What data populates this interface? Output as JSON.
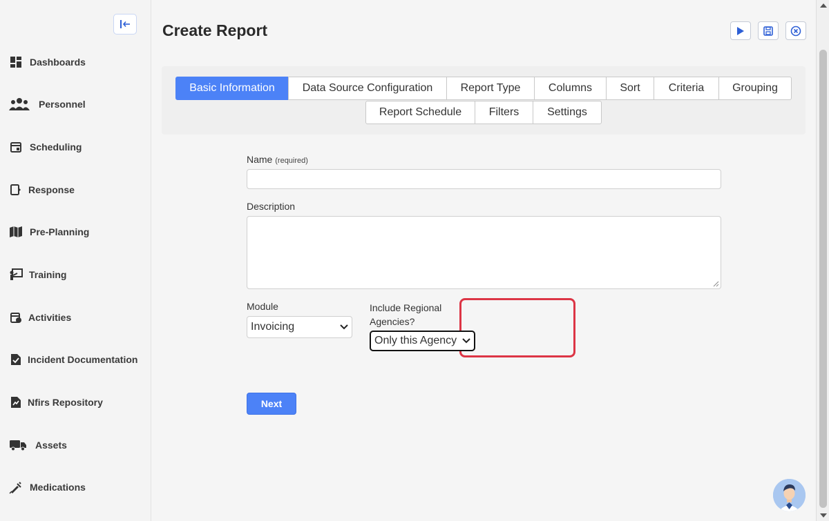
{
  "sidebar": {
    "items": [
      {
        "label": "Dashboards",
        "icon": "dashboard-icon"
      },
      {
        "label": "Personnel",
        "icon": "people-icon"
      },
      {
        "label": "Scheduling",
        "icon": "calendar-icon"
      },
      {
        "label": "Response",
        "icon": "response-icon"
      },
      {
        "label": "Pre-Planning",
        "icon": "map-icon"
      },
      {
        "label": "Training",
        "icon": "training-icon"
      },
      {
        "label": "Activities",
        "icon": "activities-icon"
      },
      {
        "label": "Incident Documentation",
        "icon": "document-check-icon"
      },
      {
        "label": "Nfirs Repository",
        "icon": "document-chart-icon"
      },
      {
        "label": "Assets",
        "icon": "truck-icon"
      },
      {
        "label": "Medications",
        "icon": "syringe-icon"
      }
    ]
  },
  "header": {
    "title": "Create Report"
  },
  "tabs": {
    "row1": [
      "Basic Information",
      "Data Source Configuration",
      "Report Type",
      "Columns",
      "Sort",
      "Criteria",
      "Grouping"
    ],
    "row2": [
      "Report Schedule",
      "Filters",
      "Settings"
    ],
    "active": "Basic Information"
  },
  "form": {
    "name_label": "Name",
    "name_required": "(required)",
    "name_value": "",
    "description_label": "Description",
    "description_value": "",
    "module_label": "Module",
    "module_value": "Invoicing",
    "regional_label_line1": "Include Regional",
    "regional_label_line2": "Agencies?",
    "regional_value": "Only this Agency",
    "next_label": "Next"
  },
  "colors": {
    "accent": "#4c82f7",
    "highlight": "#dc3545"
  }
}
